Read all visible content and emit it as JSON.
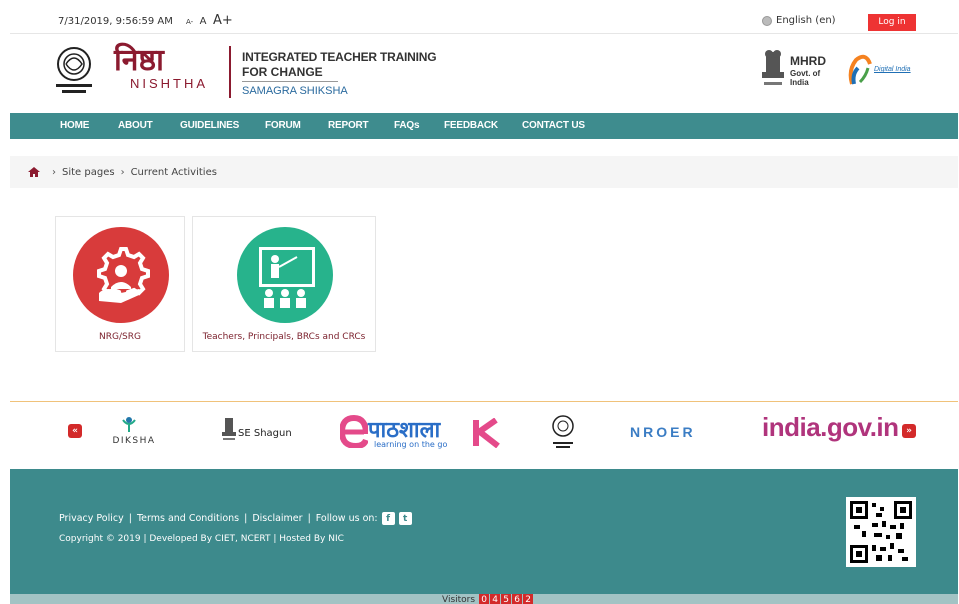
{
  "topbar": {
    "datetime": "7/31/2019, 9:56:59 AM",
    "font_small": "A-",
    "font_normal": "A",
    "font_large": "A+",
    "language": "English (en)",
    "login": "Log in"
  },
  "header": {
    "brand_hindi": "निष्ठा",
    "brand_latin": "NISHTHA",
    "tagline_1": "INTEGRATED TEACHER TRAINING",
    "tagline_2": "FOR CHANGE",
    "tagline_3": "SAMAGRA SHIKSHA",
    "mhrd": "MHRD",
    "mhrd_sub": "Govt. of India",
    "digital_india": "Digital India"
  },
  "nav": {
    "items": [
      "HOME",
      "ABOUT",
      "GUIDELINES",
      "FORUM",
      "REPORT",
      "FAQs",
      "FEEDBACK",
      "CONTACT US"
    ]
  },
  "breadcrumb": {
    "items": [
      "Site pages",
      "Current Activities"
    ]
  },
  "cards": [
    {
      "label": "NRG/SRG"
    },
    {
      "label": "Teachers, Principals, BRCs and CRCs"
    }
  ],
  "partners": {
    "diksha": "DIKSHA",
    "shagun": "SE Shagun",
    "epathshala": "पाठशाला",
    "epathshala_sub": "learning on the go",
    "nroer": "NROER",
    "india_gov": "india.gov.in"
  },
  "footer": {
    "links": [
      "Privacy Policy",
      "Terms and Conditions",
      "Disclaimer"
    ],
    "follow": "Follow us on:",
    "copyright": "Copyright © 2019 | Developed By CIET, NCERT | Hosted By NIC",
    "visitors_label": "Visitors",
    "visitor_digits": [
      "0",
      "4",
      "5",
      "6",
      "2"
    ]
  },
  "colors": {
    "teal": "#3e8c8e",
    "brand_maroon": "#8b1a2f",
    "login_red": "#e33333",
    "card_red": "#d83b3b",
    "card_green": "#27b38c"
  }
}
